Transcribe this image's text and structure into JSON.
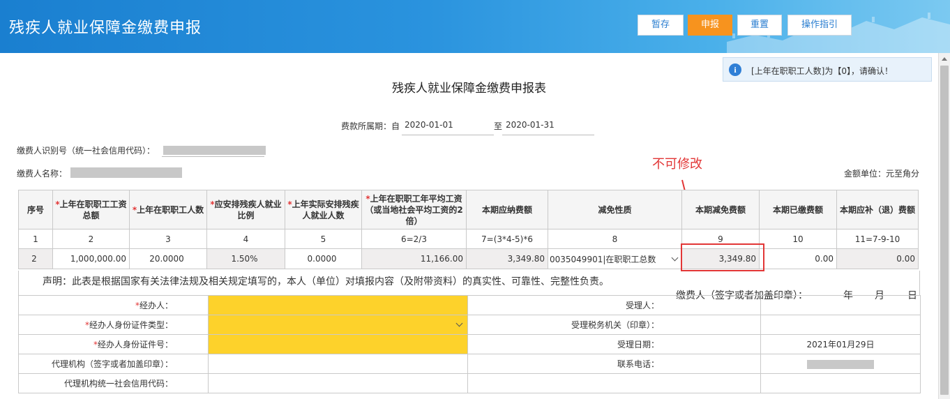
{
  "header": {
    "title": "残疾人就业保障金缴费申报",
    "buttons": {
      "save": "暂存",
      "submit": "申报",
      "reset": "重置",
      "guide": "操作指引"
    }
  },
  "notice": {
    "icon": "info-icon",
    "text": "[上年在职职工人数]为【0】，请确认！"
  },
  "form": {
    "title": "残疾人就业保障金缴费申报表",
    "period_label": "费款所属期：自",
    "period_from": "2020-01-01",
    "period_to_label": "至",
    "period_to": "2020-01-31",
    "payer_id_label": "缴费人识别号（统一社会信用代码）：",
    "payer_name_label": "缴费人名称：",
    "unit": "金额单位：元至角分",
    "annotation": "不可修改"
  },
  "table": {
    "headers": [
      {
        "text": "序号",
        "required": false
      },
      {
        "text": "上年在职职工工资总额",
        "required": true
      },
      {
        "text": "上年在职职工人数",
        "required": true
      },
      {
        "text": "应安排残疾人就业比例",
        "required": true
      },
      {
        "text": "上年实际安排残疾人就业人数",
        "required": true
      },
      {
        "text": "上年在职职工年平均工资（或当地社会平均工资的2倍）",
        "required": true
      },
      {
        "text": "本期应纳费额",
        "required": false
      },
      {
        "text": "减免性质",
        "required": false
      },
      {
        "text": "本期减免费额",
        "required": false
      },
      {
        "text": "本期已缴费额",
        "required": false
      },
      {
        "text": "本期应补（退）费额",
        "required": false
      }
    ],
    "index_row": [
      "1",
      "2",
      "3",
      "4",
      "5",
      "6=2/3",
      "7=(3*4-5)*6",
      "8",
      "9",
      "10",
      "11=7-9-10"
    ],
    "data_row": [
      "2",
      "1,000,000.00",
      "20.0000",
      "1.50%",
      "0.0000",
      "11,166.00",
      "3,349.80",
      "0035049901|在职职工总数",
      "3,349.80",
      "0.00",
      "0.00"
    ]
  },
  "declaration": {
    "text": "声明：此表是根据国家有关法律法规及相关规定填写的，本人（单位）对填报内容（及附带资料）的真实性、可靠性、完整性负责。",
    "sign": "缴费人（签字或者加盖印章）：",
    "year": "年",
    "month": "月",
    "day": "日"
  },
  "bottom": {
    "handler": "经办人：",
    "handler_id_type": "经办人身份证件类型：",
    "handler_id_no": "经办人身份证件号：",
    "agency": "代理机构（签字或者加盖印章）：",
    "agency_code": "代理机构统一社会信用代码：",
    "receiver": "受理人：",
    "tax_office": "受理税务机关（印章）：",
    "accept_date_label": "受理日期：",
    "accept_date": "2021年01月29日",
    "phone_label": "联系电话："
  },
  "colors": {
    "accent": "#f7931e",
    "header_blue": "#1a7fd0",
    "required": "#e23636",
    "highlight": "#fdd22b"
  }
}
